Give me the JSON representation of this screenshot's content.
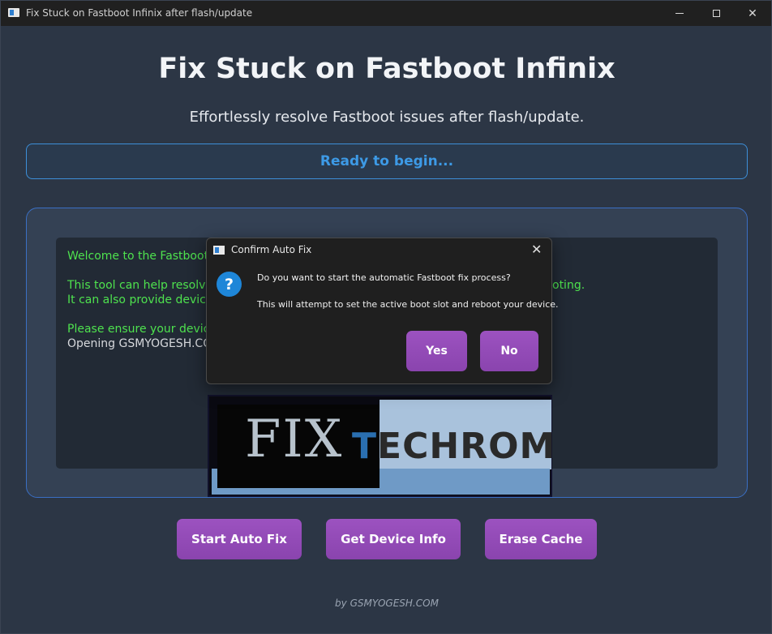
{
  "window": {
    "title": "Fix Stuck on Fastboot Infinix after flash/update",
    "controls": {
      "minimize": "minimize-icon",
      "maximize": "maximize-icon",
      "close": "✕"
    }
  },
  "main": {
    "heading": "Fix Stuck on Fastboot Infinix",
    "subheading": "Effortlessly resolve Fastboot issues after flash/update.",
    "status": "Ready to begin..."
  },
  "log": {
    "lines": [
      {
        "text": "Welcome to the Fastboot",
        "color": "#4ee24e"
      },
      {
        "text": "This tool can help resolve",
        "color": "#4ee24e"
      },
      {
        "text": "It can also provide device",
        "color": "#4ee24e"
      },
      {
        "text": "Please ensure your device",
        "color": "#4ee24e"
      },
      {
        "text": "Opening GSMYOGESH.COM",
        "color": "#d6d8dc"
      }
    ],
    "visible_fragment": "oting."
  },
  "banner": {
    "fix": "FIX",
    "techrom_first": "T",
    "techrom_rest": "ECHROM"
  },
  "buttons": {
    "start_auto_fix": "Start Auto Fix",
    "get_device_info": "Get Device Info",
    "erase_cache": "Erase Cache"
  },
  "footer": "by GSMYOGESH.COM",
  "dialog": {
    "title": "Confirm Auto Fix",
    "close": "✕",
    "icon": "?",
    "message1": "Do you want to start the automatic Fastboot fix process?",
    "message2": "This will attempt to set the active boot slot and reboot your device.",
    "yes": "Yes",
    "no": "No"
  },
  "colors": {
    "accent_purple": "#9c52c0",
    "status_blue": "#3d9ae6",
    "log_green": "#4ee24e",
    "background": "#2c3645"
  }
}
